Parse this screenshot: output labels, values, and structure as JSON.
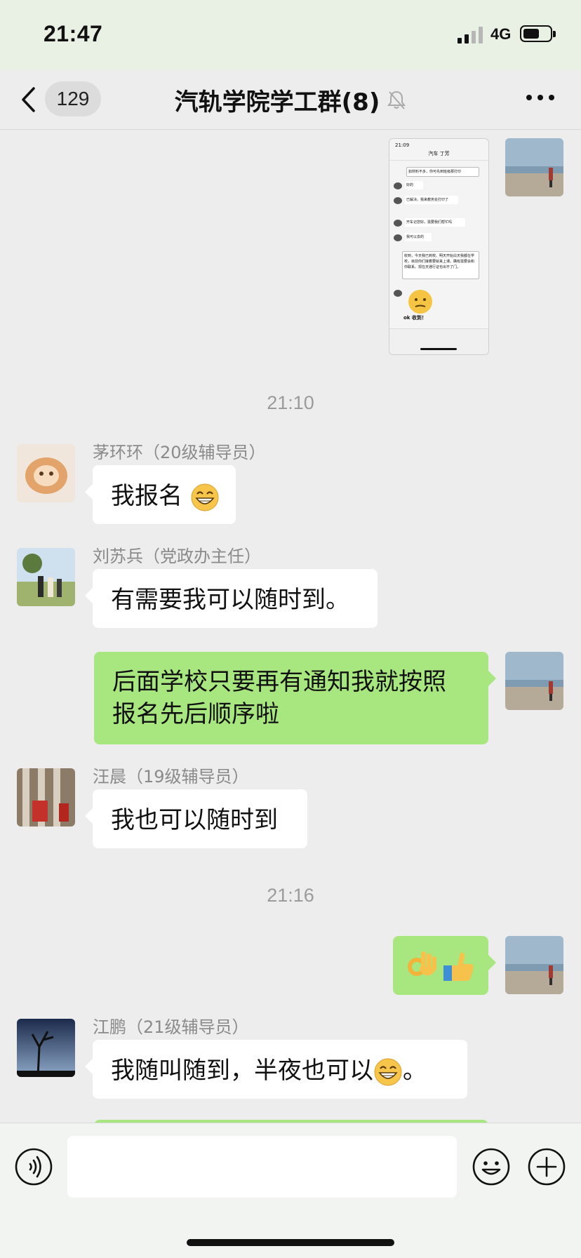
{
  "status_bar": {
    "time": "21:47",
    "network": "4G"
  },
  "header": {
    "back_badge": "129",
    "title": "汽轨学院学工群(8)"
  },
  "shared_screenshot": {
    "top_time": "21:09",
    "title": "汽车 丁芳",
    "messages": [
      "如材料不多，你可先到班级那打印",
      "好的",
      "已解决。我来教务处打印了",
      "开车记您好。需要我们帮忙吗",
      "我可以去的",
      "收到，今天我已到校。明天开始白天我都在学校，目前你们接着要就来上课。确有需要会和你联系。现在天通行证也出不了门。"
    ],
    "sticker_caption": "ok 收到！"
  },
  "messages": [
    {
      "type": "time",
      "text": "21:10"
    },
    {
      "type": "in",
      "sender": "茅环环（20级辅导员）",
      "text": "我报名",
      "emoji": "grin"
    },
    {
      "type": "in",
      "sender": "刘苏兵（党政办主任）",
      "text": "有需要我可以随时到。"
    },
    {
      "type": "out",
      "lines": [
        "后面学校只要再有通知我就按照",
        "报名先后顺序啦"
      ]
    },
    {
      "type": "in",
      "sender": "汪晨（19级辅导员）",
      "text": "我也可以随时到"
    },
    {
      "type": "time",
      "text": "21:16"
    },
    {
      "type": "out",
      "emojis": [
        "ok-hand",
        "thumbs-up"
      ]
    },
    {
      "type": "in",
      "sender": "江鹏（21级辅导员）",
      "text_before": "我随叫随到，半夜也可以",
      "emoji": "grin",
      "text_after": "。"
    }
  ],
  "input": {
    "placeholder": ""
  },
  "colors": {
    "outgoing_bubble": "#a8e77f",
    "incoming_bubble": "#ffffff",
    "background": "#ededed"
  }
}
